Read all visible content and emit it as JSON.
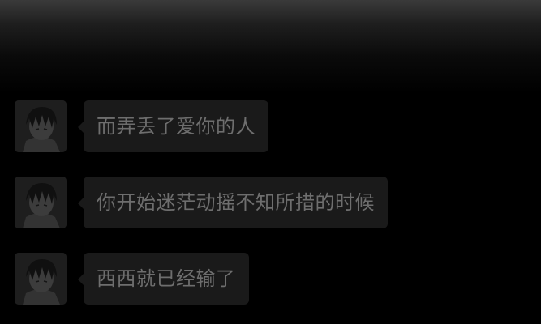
{
  "chat": {
    "messages": [
      {
        "text": "而弄丢了爱你的人",
        "avatar_icon": "anime-boy-avatar"
      },
      {
        "text": "你开始迷茫动摇不知所措的时候",
        "avatar_icon": "anime-boy-avatar"
      },
      {
        "text": "西西就已经输了",
        "avatar_icon": "anime-boy-avatar"
      }
    ]
  },
  "colors": {
    "background": "#000000",
    "bubble": "#1a1a1a",
    "text": "#6e6e6e"
  }
}
